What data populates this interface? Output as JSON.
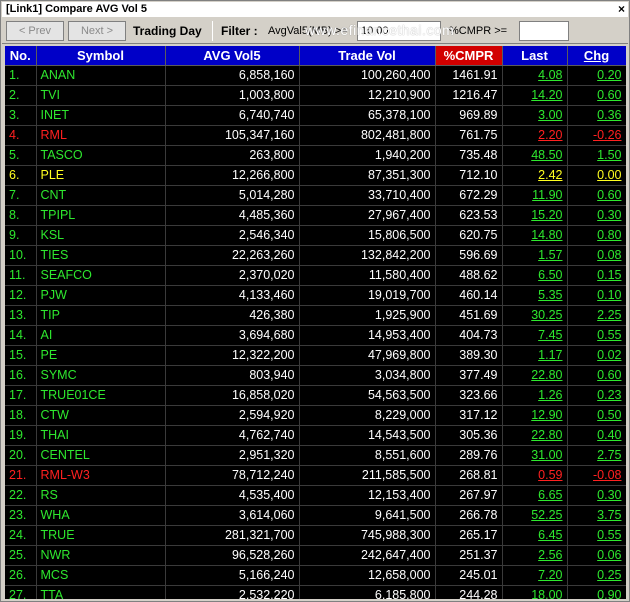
{
  "window": {
    "title": "[Link1] Compare AVG Vol 5",
    "close": "×"
  },
  "toolbar": {
    "prev": "< Prev",
    "next": "Next >",
    "trading_day": "Trading Day",
    "filter_label": "Filter :",
    "avgvol_label": "AvgVal5(MB) >=",
    "avgvol_value": "10.00",
    "cmpr_label": "%CMPR >=",
    "cmpr_value": "",
    "watermark": "www.efinancethai.com"
  },
  "colors": {
    "header_bg": "#0000c8",
    "header_highlight": "#d20000",
    "up": "#2ee82e",
    "down": "#ff2020",
    "unchanged": "#ffff20"
  },
  "table": {
    "columns": [
      "No.",
      "Symbol",
      "AVG Vol5",
      "Trade Vol",
      "%CMPR",
      "Last",
      "Chg"
    ],
    "rows": [
      {
        "no": "1.",
        "symbol": "ANAN",
        "avg": "6,858,160",
        "trade": "100,260,400",
        "cmpr": "1461.91",
        "last": "4.08",
        "chg": "0.20",
        "dir": "up"
      },
      {
        "no": "2.",
        "symbol": "TVI",
        "avg": "1,003,800",
        "trade": "12,210,900",
        "cmpr": "1216.47",
        "last": "14.20",
        "chg": "0.60",
        "dir": "up"
      },
      {
        "no": "3.",
        "symbol": "INET",
        "avg": "6,740,740",
        "trade": "65,378,100",
        "cmpr": "969.89",
        "last": "3.00",
        "chg": "0.36",
        "dir": "up"
      },
      {
        "no": "4.",
        "symbol": "RML",
        "avg": "105,347,160",
        "trade": "802,481,800",
        "cmpr": "761.75",
        "last": "2.20",
        "chg": "-0.26",
        "dir": "down"
      },
      {
        "no": "5.",
        "symbol": "TASCO",
        "avg": "263,800",
        "trade": "1,940,200",
        "cmpr": "735.48",
        "last": "48.50",
        "chg": "1.50",
        "dir": "up"
      },
      {
        "no": "6.",
        "symbol": "PLE",
        "avg": "12,266,800",
        "trade": "87,351,300",
        "cmpr": "712.10",
        "last": "2.42",
        "chg": "0.00",
        "dir": "flat"
      },
      {
        "no": "7.",
        "symbol": "CNT",
        "avg": "5,014,280",
        "trade": "33,710,400",
        "cmpr": "672.29",
        "last": "11.90",
        "chg": "0.60",
        "dir": "up"
      },
      {
        "no": "8.",
        "symbol": "TPIPL",
        "avg": "4,485,360",
        "trade": "27,967,400",
        "cmpr": "623.53",
        "last": "15.20",
        "chg": "0.30",
        "dir": "up"
      },
      {
        "no": "9.",
        "symbol": "KSL",
        "avg": "2,546,340",
        "trade": "15,806,500",
        "cmpr": "620.75",
        "last": "14.80",
        "chg": "0.80",
        "dir": "up"
      },
      {
        "no": "10.",
        "symbol": "TIES",
        "avg": "22,263,260",
        "trade": "132,842,200",
        "cmpr": "596.69",
        "last": "1.57",
        "chg": "0.08",
        "dir": "up"
      },
      {
        "no": "11.",
        "symbol": "SEAFCO",
        "avg": "2,370,020",
        "trade": "11,580,400",
        "cmpr": "488.62",
        "last": "6.50",
        "chg": "0.15",
        "dir": "up"
      },
      {
        "no": "12.",
        "symbol": "PJW",
        "avg": "4,133,460",
        "trade": "19,019,700",
        "cmpr": "460.14",
        "last": "5.35",
        "chg": "0.10",
        "dir": "up"
      },
      {
        "no": "13.",
        "symbol": "TIP",
        "avg": "426,380",
        "trade": "1,925,900",
        "cmpr": "451.69",
        "last": "30.25",
        "chg": "2.25",
        "dir": "up"
      },
      {
        "no": "14.",
        "symbol": "AI",
        "avg": "3,694,680",
        "trade": "14,953,400",
        "cmpr": "404.73",
        "last": "7.45",
        "chg": "0.55",
        "dir": "up"
      },
      {
        "no": "15.",
        "symbol": "PE",
        "avg": "12,322,200",
        "trade": "47,969,800",
        "cmpr": "389.30",
        "last": "1.17",
        "chg": "0.02",
        "dir": "up"
      },
      {
        "no": "16.",
        "symbol": "SYMC",
        "avg": "803,940",
        "trade": "3,034,800",
        "cmpr": "377.49",
        "last": "22.80",
        "chg": "0.60",
        "dir": "up"
      },
      {
        "no": "17.",
        "symbol": "TRUE01CE",
        "avg": "16,858,020",
        "trade": "54,563,500",
        "cmpr": "323.66",
        "last": "1.26",
        "chg": "0.23",
        "dir": "up"
      },
      {
        "no": "18.",
        "symbol": "CTW",
        "avg": "2,594,920",
        "trade": "8,229,000",
        "cmpr": "317.12",
        "last": "12.90",
        "chg": "0.50",
        "dir": "up"
      },
      {
        "no": "19.",
        "symbol": "THAI",
        "avg": "4,762,740",
        "trade": "14,543,500",
        "cmpr": "305.36",
        "last": "22.80",
        "chg": "0.40",
        "dir": "up"
      },
      {
        "no": "20.",
        "symbol": "CENTEL",
        "avg": "2,951,320",
        "trade": "8,551,600",
        "cmpr": "289.76",
        "last": "31.00",
        "chg": "2.75",
        "dir": "up"
      },
      {
        "no": "21.",
        "symbol": "RML-W3",
        "avg": "78,712,240",
        "trade": "211,585,500",
        "cmpr": "268.81",
        "last": "0.59",
        "chg": "-0.08",
        "dir": "down"
      },
      {
        "no": "22.",
        "symbol": "RS",
        "avg": "4,535,400",
        "trade": "12,153,400",
        "cmpr": "267.97",
        "last": "6.65",
        "chg": "0.30",
        "dir": "up"
      },
      {
        "no": "23.",
        "symbol": "WHA",
        "avg": "3,614,060",
        "trade": "9,641,500",
        "cmpr": "266.78",
        "last": "52.25",
        "chg": "3.75",
        "dir": "up"
      },
      {
        "no": "24.",
        "symbol": "TRUE",
        "avg": "281,321,700",
        "trade": "745,988,300",
        "cmpr": "265.17",
        "last": "6.45",
        "chg": "0.55",
        "dir": "up"
      },
      {
        "no": "25.",
        "symbol": "NWR",
        "avg": "96,528,260",
        "trade": "242,647,400",
        "cmpr": "251.37",
        "last": "2.56",
        "chg": "0.06",
        "dir": "up"
      },
      {
        "no": "26.",
        "symbol": "MCS",
        "avg": "5,166,240",
        "trade": "12,658,000",
        "cmpr": "245.01",
        "last": "7.20",
        "chg": "0.25",
        "dir": "up"
      },
      {
        "no": "27.",
        "symbol": "TTA",
        "avg": "2,532,220",
        "trade": "6,185,800",
        "cmpr": "244.28",
        "last": "18.00",
        "chg": "0.90",
        "dir": "up"
      }
    ]
  }
}
